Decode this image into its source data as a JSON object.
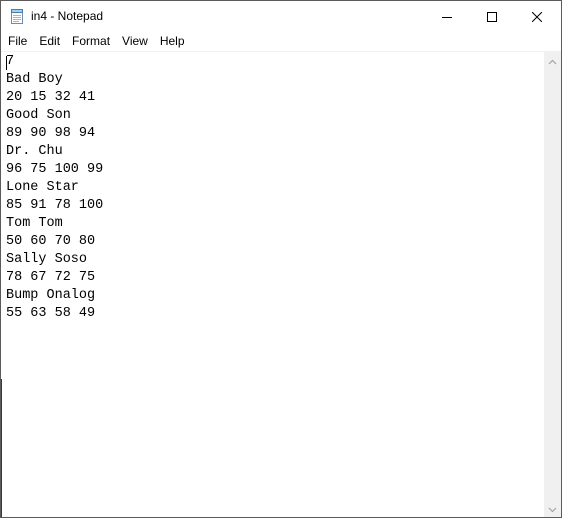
{
  "window": {
    "title": "in4 - Notepad",
    "icon": "notepad-icon"
  },
  "title_buttons": {
    "minimize": "minimize-icon",
    "maximize": "maximize-icon",
    "close": "close-icon"
  },
  "menu": {
    "items": [
      {
        "label": "File"
      },
      {
        "label": "Edit"
      },
      {
        "label": "Format"
      },
      {
        "label": "View"
      },
      {
        "label": "Help"
      }
    ]
  },
  "editor": {
    "lines": [
      "7",
      "Bad Boy",
      "20 15 32 41",
      "Good Son",
      "89 90 98 94",
      "Dr. Chu",
      "96 75 100 99",
      "Lone Star",
      "85 91 78 100",
      "Tom Tom",
      "50 60 70 80",
      "Sally Soso",
      "78 67 72 75",
      "Bump Onalog",
      "55 63 58 49"
    ]
  },
  "scrollbar": {
    "up": "chevron-up-icon",
    "down": "chevron-down-icon"
  },
  "colors": {
    "background": "#ffffff",
    "text": "#000000",
    "scrollbar_track": "#f0f0f0",
    "scroll_arrow": "#a3a3a3",
    "border": "#5b5b5b"
  }
}
